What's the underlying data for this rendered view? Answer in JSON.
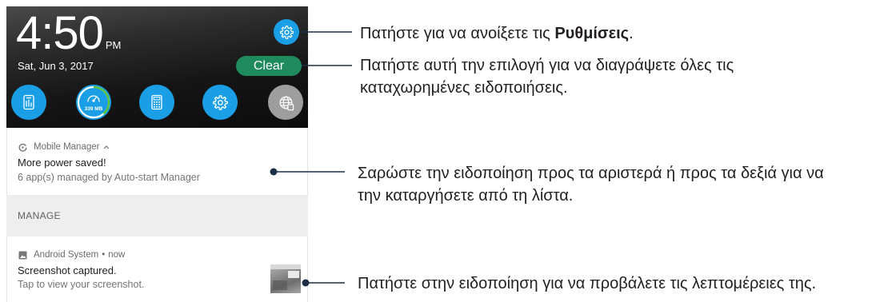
{
  "panel": {
    "clock": {
      "time": "4:50",
      "ampm": "PM"
    },
    "date": "Sat, Jun 3, 2017",
    "settings_button": {
      "icon": "gear-icon"
    },
    "clear_button": {
      "label": "Clear"
    },
    "quick_settings": [
      {
        "icon": "mobile-manager-icon"
      },
      {
        "icon": "memory-boost-gauge-icon",
        "label": "339 MB"
      },
      {
        "icon": "calculator-icon"
      },
      {
        "icon": "gear-icon"
      },
      {
        "icon": "globe-icon"
      }
    ],
    "notifications": [
      {
        "app": "Mobile Manager",
        "app_icon": "mobile-manager-app-icon",
        "expand_icon": "chevron-up-icon",
        "title": "More power saved!",
        "text": "6 app(s) managed by Auto-start Manager",
        "action": "MANAGE"
      },
      {
        "app": "Android System",
        "separator": "•",
        "time": "now",
        "app_icon": "image-icon",
        "title": "Screenshot captured.",
        "text": "Tap to view your screenshot."
      }
    ]
  },
  "callouts": [
    {
      "before": "Πατήστε για να ανοίξετε τις ",
      "bold": "Ρυθμίσεις",
      "after": "."
    },
    {
      "lines": [
        "Πατήστε αυτή την επιλογή για να διαγράψετε όλες τις",
        "καταχωρημένες ειδοποιήσεις."
      ]
    },
    {
      "lines": [
        "Σαρώστε την ειδοποίηση προς τα αριστερά ή προς τα δεξιά για να",
        "την καταργήσετε από τη λίστα."
      ]
    },
    {
      "lines": [
        "Πατήστε στην ειδοποίηση για να προβάλετε τις λεπτομέρειες της."
      ]
    }
  ],
  "colors": {
    "accent_blue": "#1a9fe6",
    "clear_green": "#1e8a5d",
    "boost_green": "#5cc23c",
    "disabled_gray": "#9e9e9e",
    "action_bar": "#eeeeee",
    "callout_line": "#1d2f46",
    "callout_text": "#231f20"
  }
}
